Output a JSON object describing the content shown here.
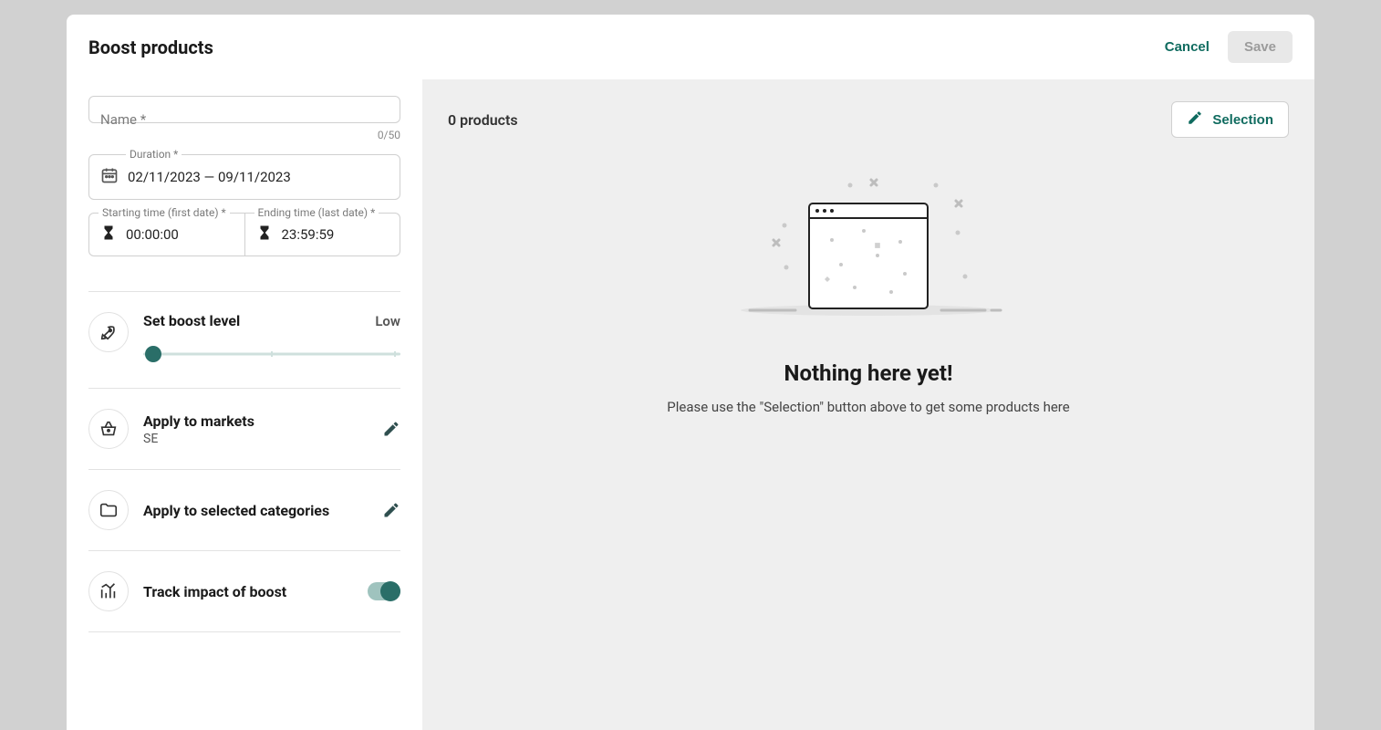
{
  "modal": {
    "title": "Boost products",
    "cancel": "Cancel",
    "save": "Save"
  },
  "left": {
    "name_label": "Name *",
    "name_count": "0/50",
    "duration_label": "Duration *",
    "duration_value": "02/11/2023 — 09/11/2023",
    "start_label": "Starting time (first date) *",
    "start_value": "00:00:00",
    "end_label": "Ending time (last date) *",
    "end_value": "23:59:59",
    "boost_title": "Set boost level",
    "boost_level": "Low",
    "markets_title": "Apply to markets",
    "markets_value": "SE",
    "categories_title": "Apply to selected categories",
    "track_title": "Track impact of boost",
    "track_enabled": true
  },
  "right": {
    "count": "0 products",
    "selection_btn": "Selection",
    "empty_title": "Nothing here yet!",
    "empty_sub": "Please use the \"Selection\" button above to get some products here"
  }
}
